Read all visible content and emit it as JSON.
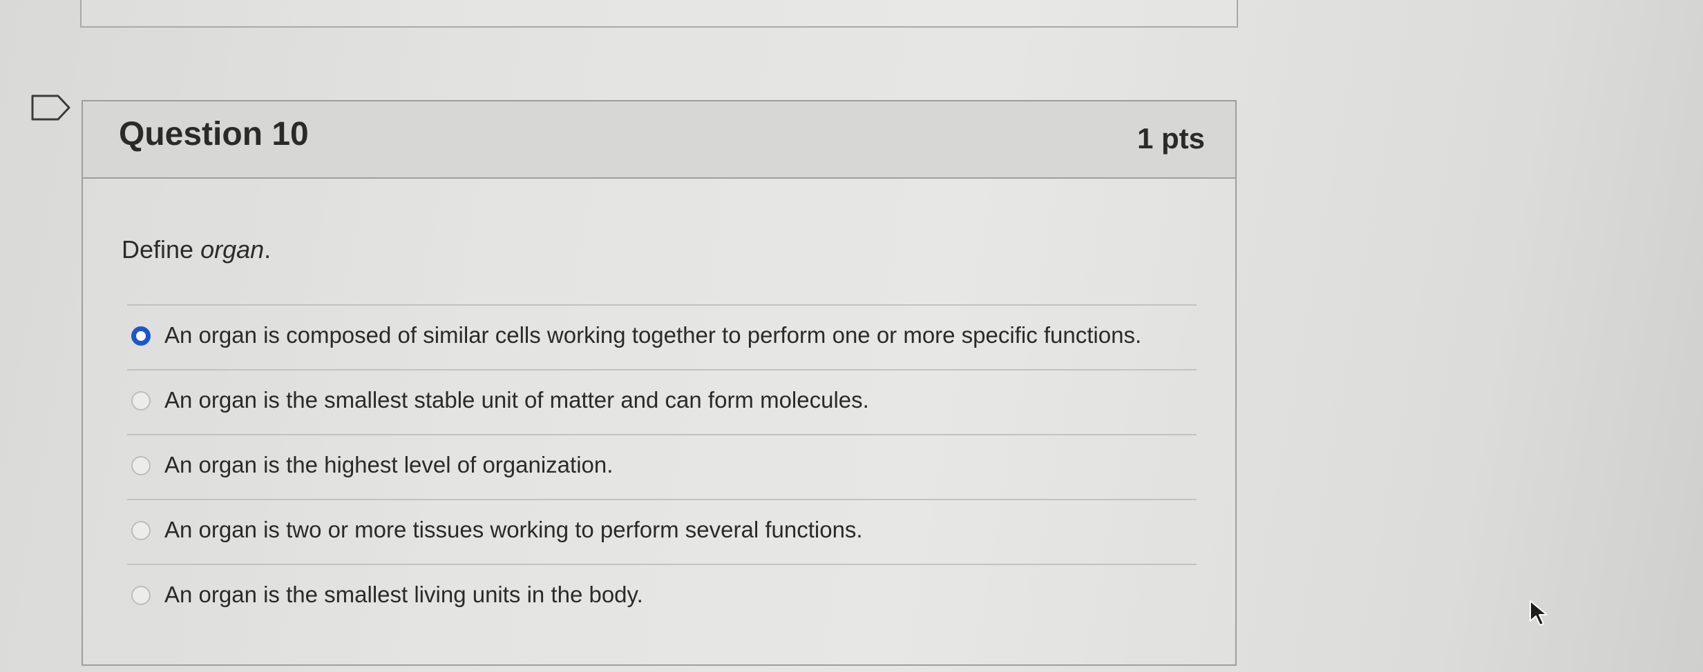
{
  "question": {
    "title": "Question 10",
    "points": "1 pts",
    "prompt_prefix": "Define ",
    "prompt_term": "organ",
    "prompt_suffix": ".",
    "answers": [
      {
        "label": "An organ is composed of similar cells working together to perform one or more specific functions.",
        "selected": true
      },
      {
        "label": "An organ is the smallest stable unit of matter and can form molecules.",
        "selected": false
      },
      {
        "label": "An organ is the highest level of organization.",
        "selected": false
      },
      {
        "label": "An organ is two or more tissues working to perform several functions.",
        "selected": false
      },
      {
        "label": "An organ is the smallest living units in the body.",
        "selected": false
      }
    ]
  },
  "colors": {
    "selected_radio": "#1d56c8",
    "header_bg": "#d7d7d5",
    "border": "#9e9e9c"
  },
  "icons": {
    "flag": "flag-icon",
    "cursor": "mouse-cursor-icon"
  }
}
